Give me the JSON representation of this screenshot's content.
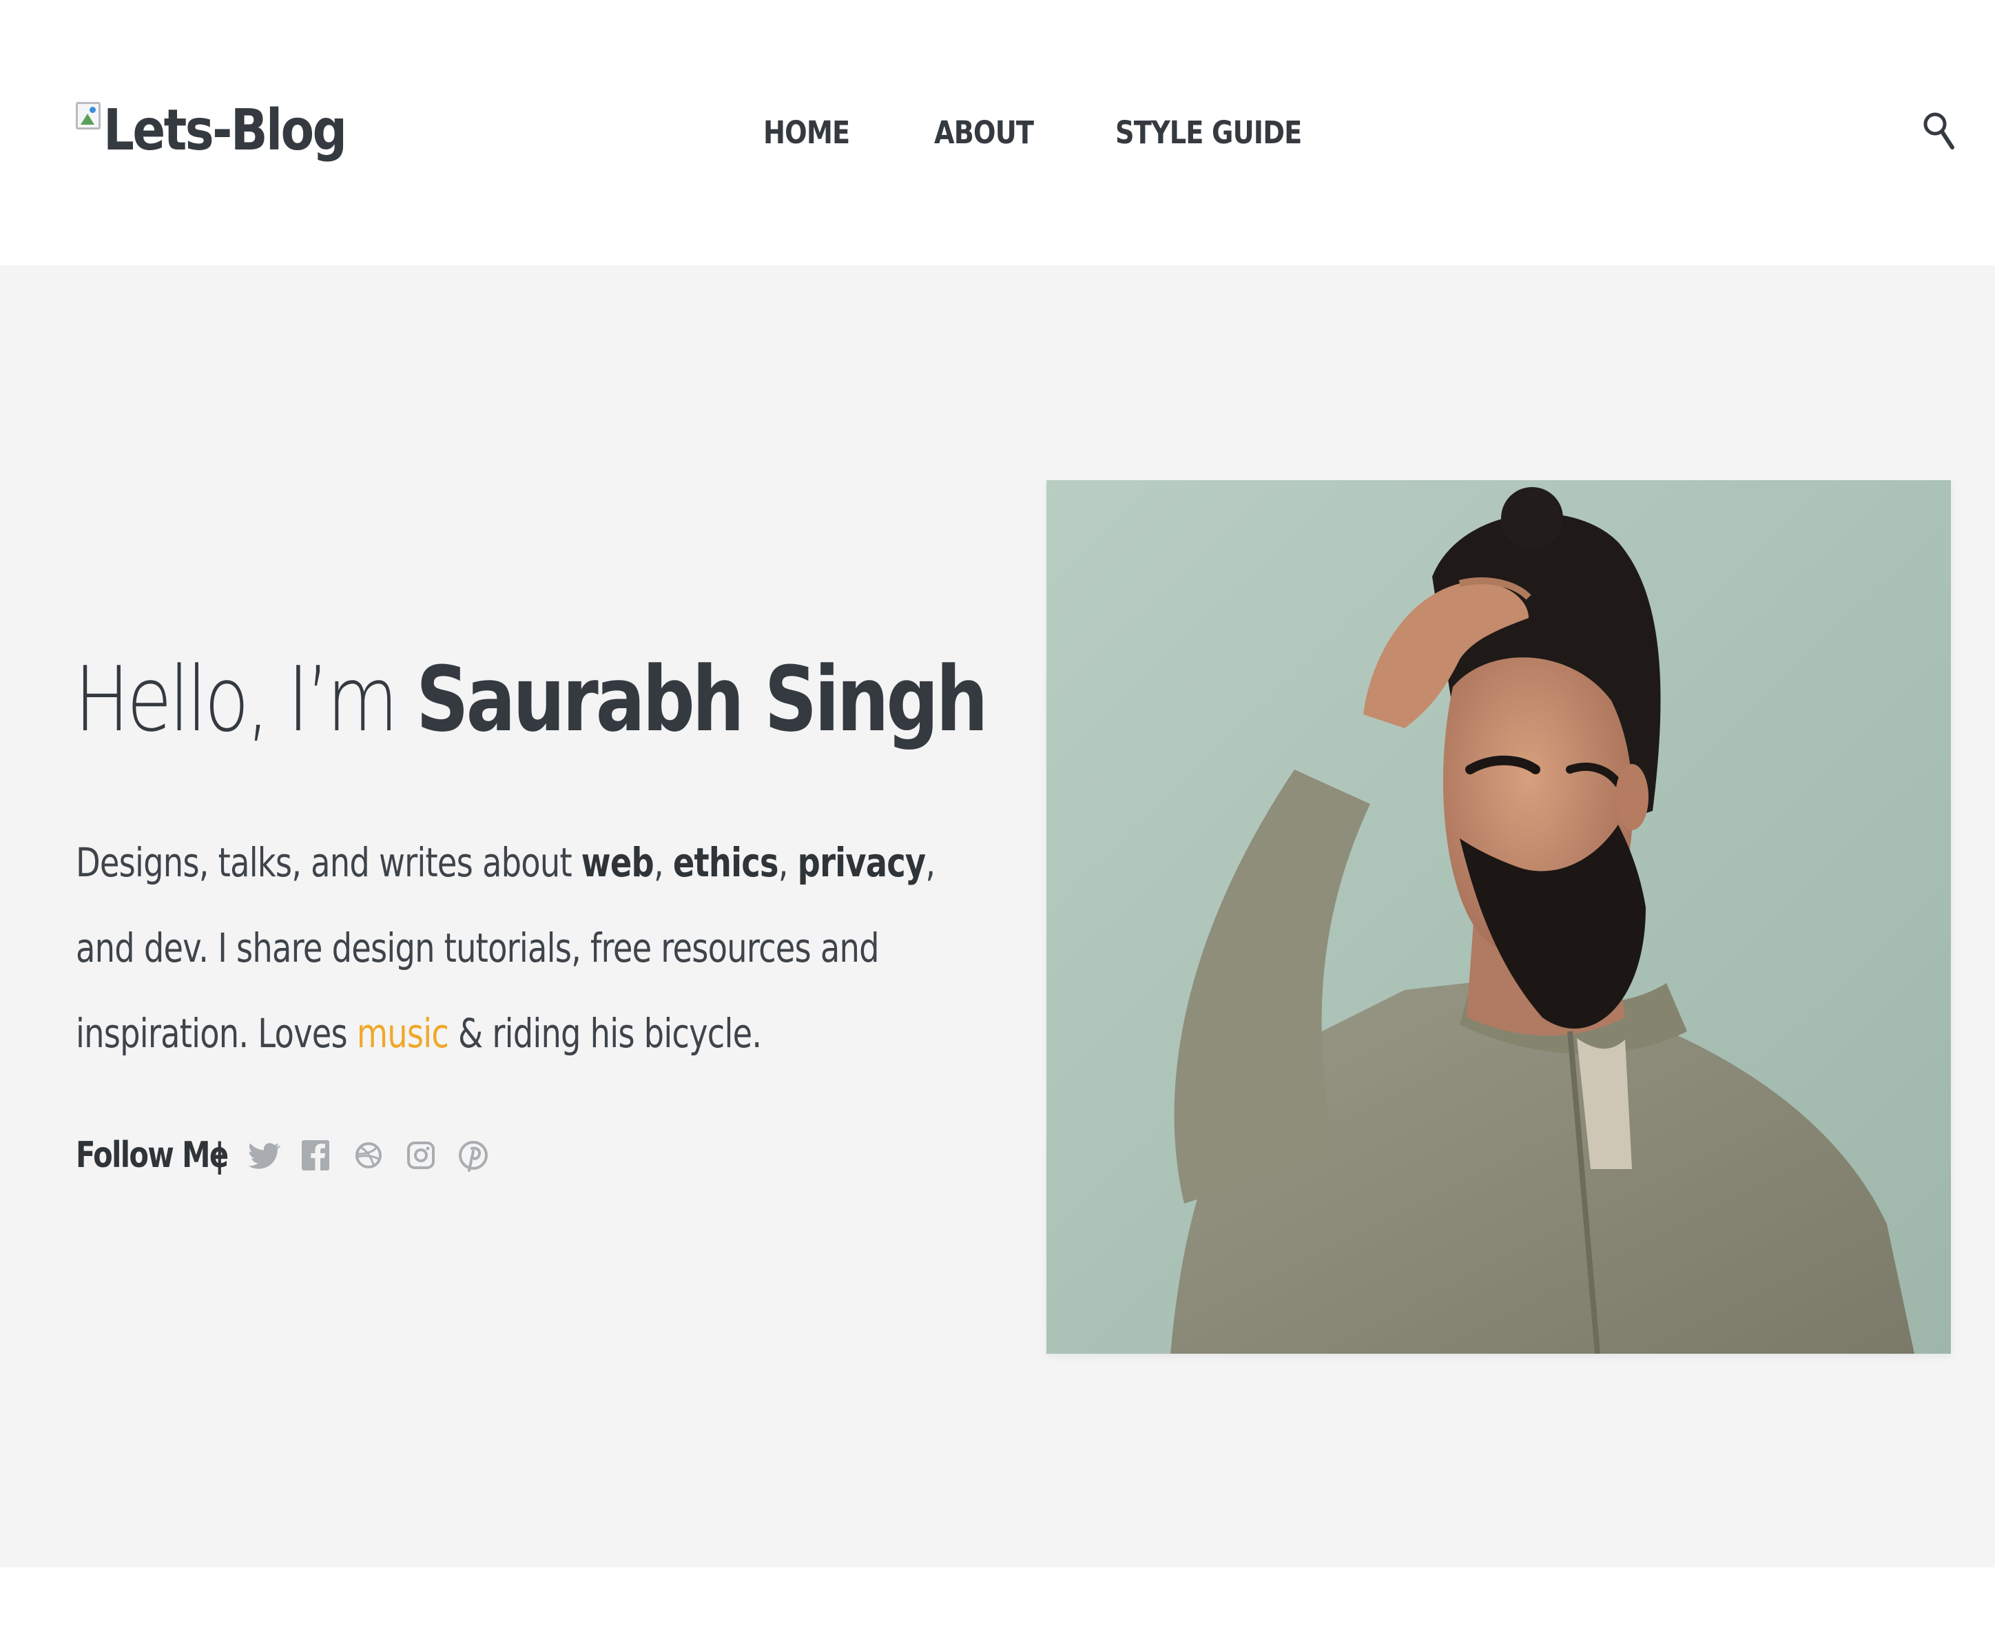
{
  "header": {
    "logo_alt": "Lets-Blog",
    "nav": [
      "HOME",
      "ABOUT",
      "STYLE GUIDE"
    ],
    "search_icon": "search-icon"
  },
  "hero": {
    "greeting_prefix": "Hello, I’m ",
    "name": "Saurabh Singh",
    "bio": {
      "part1": "Designs, talks, and writes about ",
      "web": "web",
      "comma1": ", ",
      "ethics": "ethics",
      "comma2": ", ",
      "privacy": "privacy",
      "part2": ", and dev. I share design tutorials, free resources and inspiration. Loves ",
      "music": "music",
      "part3": " & riding his bicycle."
    },
    "follow_label": "Follow Me",
    "follow_separator": "|",
    "social_icons": [
      "twitter-icon",
      "facebook-icon",
      "dribbble-icon",
      "instagram-icon",
      "pinterest-icon"
    ],
    "photo_description_icon": "portrait-photo"
  },
  "colors": {
    "text": "#343a40",
    "accent": "#f0a82a",
    "hero_bg": "#f4f4f4",
    "icon_gray": "#a9adb1"
  }
}
